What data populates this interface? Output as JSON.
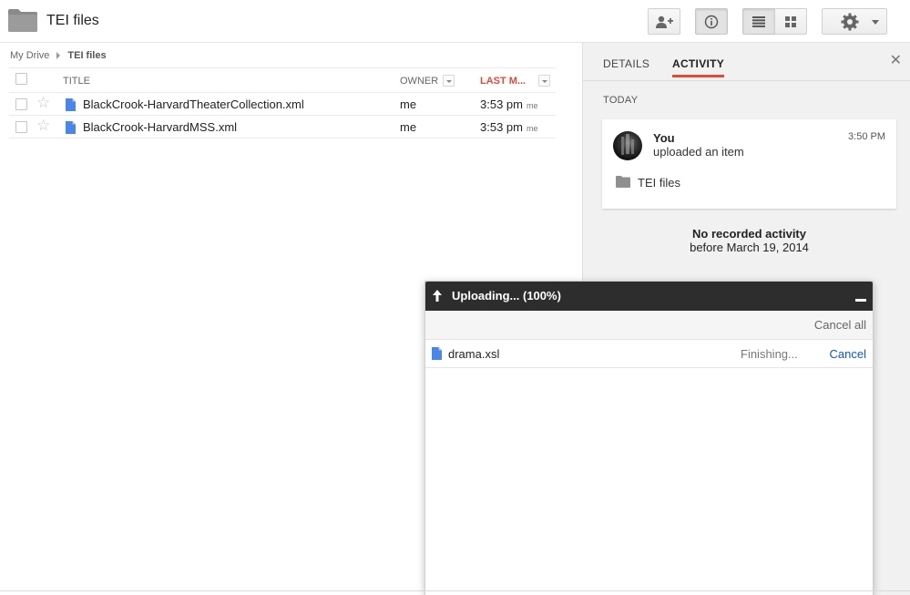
{
  "header": {
    "folder_icon": "folder-icon",
    "title": "TEI files",
    "buttons": {
      "share_icon": "add-person-icon",
      "info_icon": "info-icon",
      "list_view_icon": "list-view-icon",
      "grid_view_icon": "grid-view-icon",
      "settings_icon": "gear-icon"
    }
  },
  "breadcrumb": {
    "root": "My Drive",
    "current": "TEI files"
  },
  "file_list": {
    "columns": {
      "title": "TITLE",
      "owner": "OWNER",
      "last_modified": "LAST M..."
    },
    "rows": [
      {
        "name": "BlackCrook-HarvardTheaterCollection.xml",
        "owner": "me",
        "modified": "3:53 pm",
        "modified_by": "me"
      },
      {
        "name": "BlackCrook-HarvardMSS.xml",
        "owner": "me",
        "modified": "3:53 pm",
        "modified_by": "me"
      }
    ]
  },
  "side_panel": {
    "tabs": {
      "details": "DETAILS",
      "activity": "ACTIVITY"
    },
    "active_tab": "activity",
    "section_label": "TODAY",
    "activity": {
      "user": "You",
      "action": "uploaded an item",
      "time": "3:50 PM",
      "target": "TEI files"
    },
    "no_activity": {
      "line1": "No recorded activity",
      "line2": "before March 19, 2014"
    }
  },
  "upload_dialog": {
    "title": "Uploading... (100%)",
    "progress": 1.0,
    "cancel_all": "Cancel all",
    "items": [
      {
        "name": "drama.xsl",
        "status": "Finishing...",
        "action": "Cancel"
      }
    ]
  },
  "colors": {
    "accent_red": "#dd4b39",
    "doc_blue": "#4a86e8",
    "link_blue": "#1155cc",
    "upload_header": "#2d2d2d"
  }
}
